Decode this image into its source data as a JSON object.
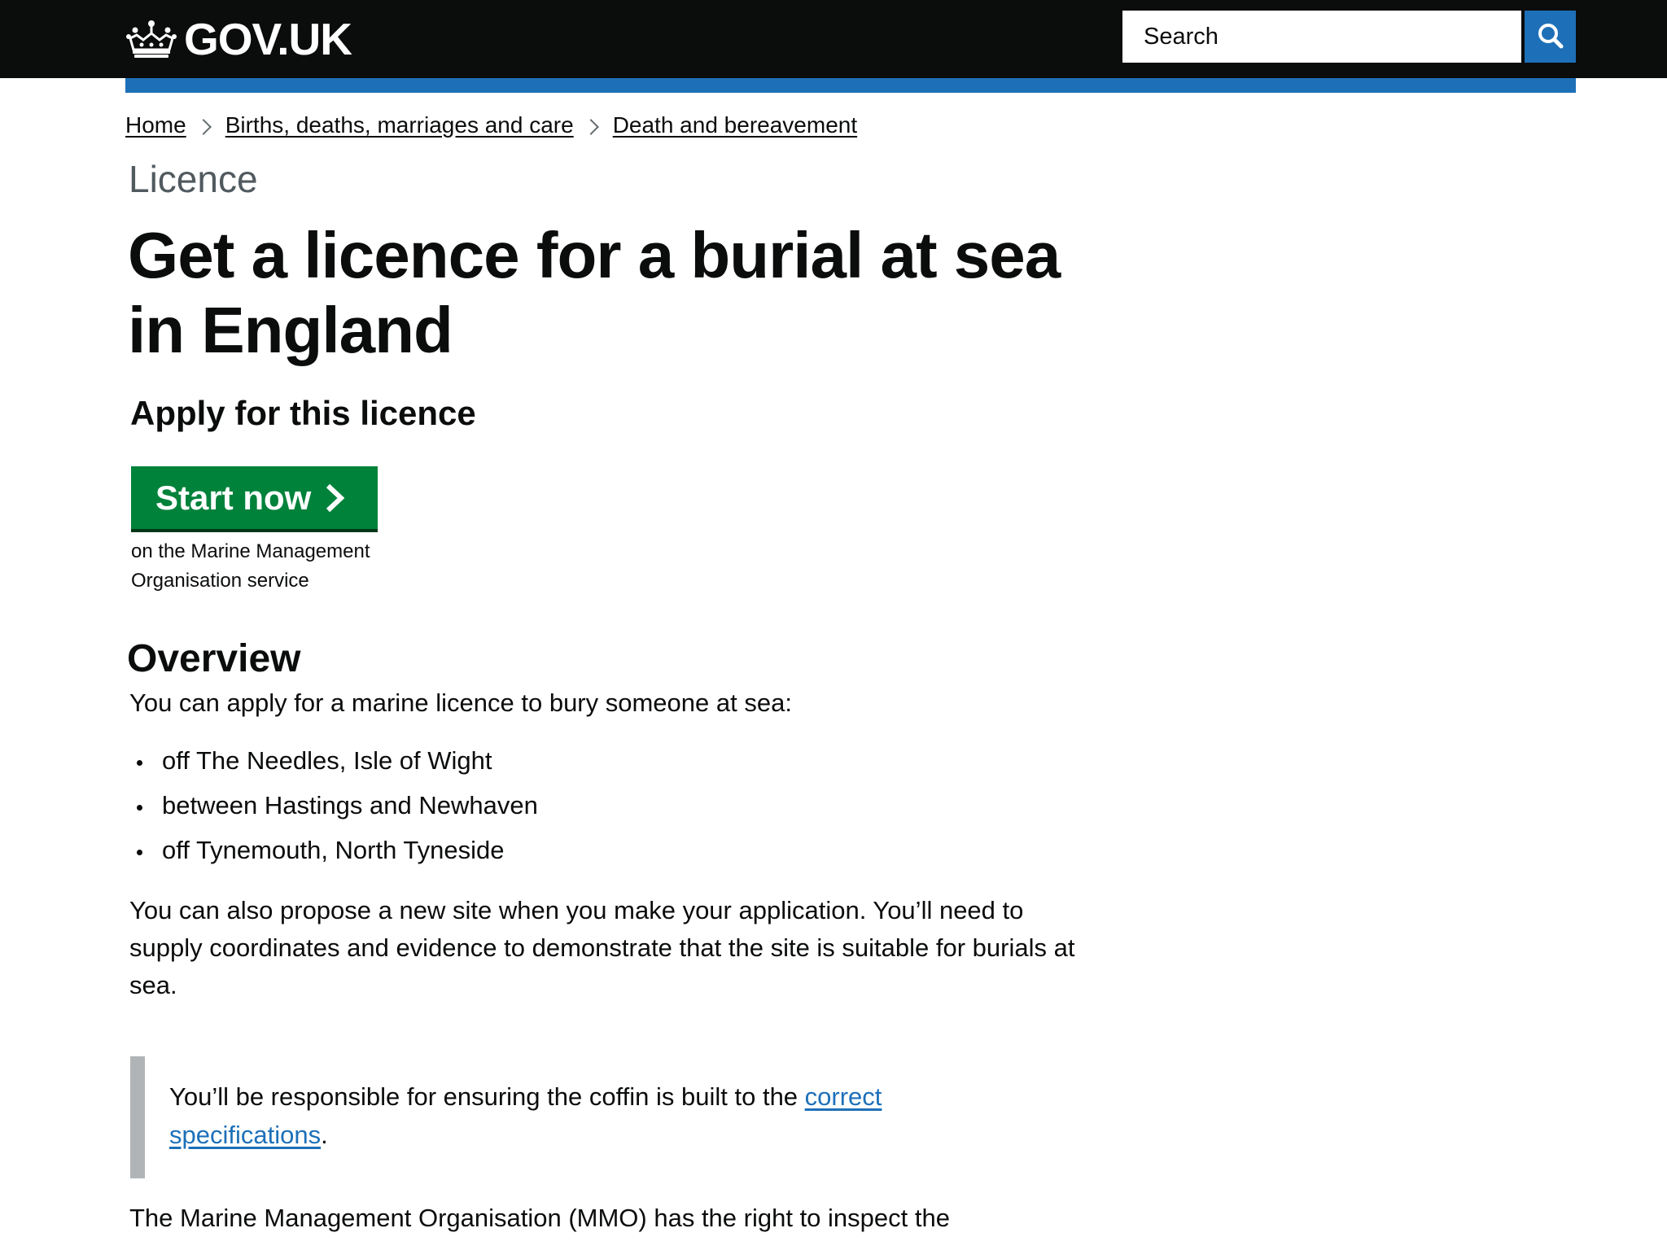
{
  "header": {
    "logo_text": "GOV.UK",
    "search_placeholder": "Search",
    "colors": {
      "background": "#0b0c0c",
      "accent_bar": "#1d70b8",
      "search_button": "#1d70b8"
    }
  },
  "breadcrumb": {
    "items": [
      {
        "label": "Home"
      },
      {
        "label": "Births, deaths, marriages and care"
      },
      {
        "label": "Death and bereavement"
      }
    ]
  },
  "content": {
    "caption": "Licence",
    "title": "Get a licence for a burial at sea in England",
    "apply_heading": "Apply for this licence",
    "start_button_label": "Start now",
    "start_button_color": "#00823b",
    "service_note": "on the Marine Management Organisation service",
    "overview_heading": "Overview",
    "intro": "You can apply for a marine licence to bury someone at sea:",
    "sites": [
      "off The Needles, Isle of Wight",
      "between Hastings and Newhaven",
      "off Tynemouth, North Tyneside"
    ],
    "propose_text": "You can also propose a new site when you make your application. You’ll need to supply coordinates and evidence to demonstrate that the site is suitable for burials at sea.",
    "inset": {
      "text_before": "You’ll be responsible for ensuring the coffin is built to the ",
      "link_text": "correct specifications",
      "text_after": "."
    },
    "mmo_text": "The Marine Management Organisation (MMO) has the right to inspect the"
  }
}
